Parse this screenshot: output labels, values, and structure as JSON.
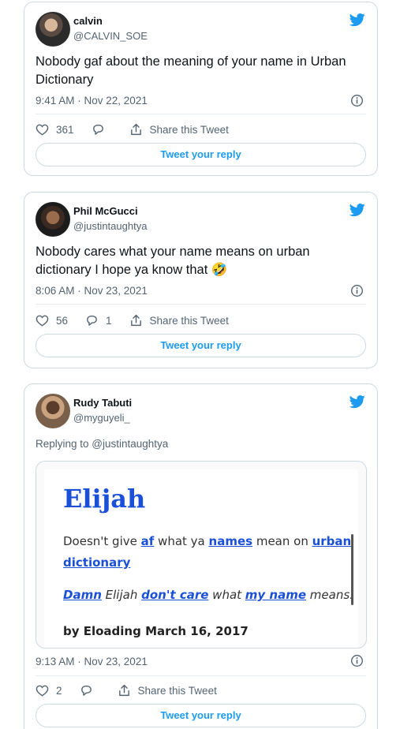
{
  "tweets": [
    {
      "name": "calvin",
      "handle": "@CALVIN_SOE",
      "text": "Nobody gaf about the meaning of your name in Urban Dictionary",
      "time": "9:41 AM · Nov 22, 2021",
      "likes": "361",
      "replies": "",
      "share": "Share this Tweet",
      "reply_button": "Tweet your reply"
    },
    {
      "name": "Phil McGucci",
      "handle": "@justintaughtya",
      "text": "Nobody cares what your name means on urban dictionary I hope ya know that 🤣",
      "time": "8:06 AM · Nov 23, 2021",
      "likes": "56",
      "replies": "1",
      "share": "Share this Tweet",
      "reply_button": "Tweet your reply"
    },
    {
      "name": "Rudy Tabuti",
      "handle": "@myguyeli_",
      "replying_to": "Replying to @justintaughtya",
      "time": "9:13 AM · Nov 23, 2021",
      "likes": "2",
      "replies": "",
      "share": "Share this Tweet",
      "reply_button": "Tweet your reply",
      "media": {
        "word": "Elijah",
        "def_1": "Doesn't give ",
        "def_link_1": "af",
        "def_2": " what ya ",
        "def_link_2": "names",
        "def_3": " mean on ",
        "def_link_3": "urban dictionary",
        "ex_link_1": "Damn",
        "ex_1": " Elijah ",
        "ex_link_2": "don't care",
        "ex_2": " what ",
        "ex_link_3": "my name",
        "ex_3": " means.",
        "by": "by Eloading March 16, 2017"
      }
    }
  ],
  "icons": {
    "brand": "twitter-bird-icon",
    "info": "info-icon",
    "like": "heart-icon",
    "reply": "reply-bubble-icon",
    "share": "share-icon"
  },
  "colors": {
    "accent": "#1d9bf0",
    "text": "#0f1419",
    "muted": "#536471",
    "ud_blue": "#1a4fd8"
  }
}
